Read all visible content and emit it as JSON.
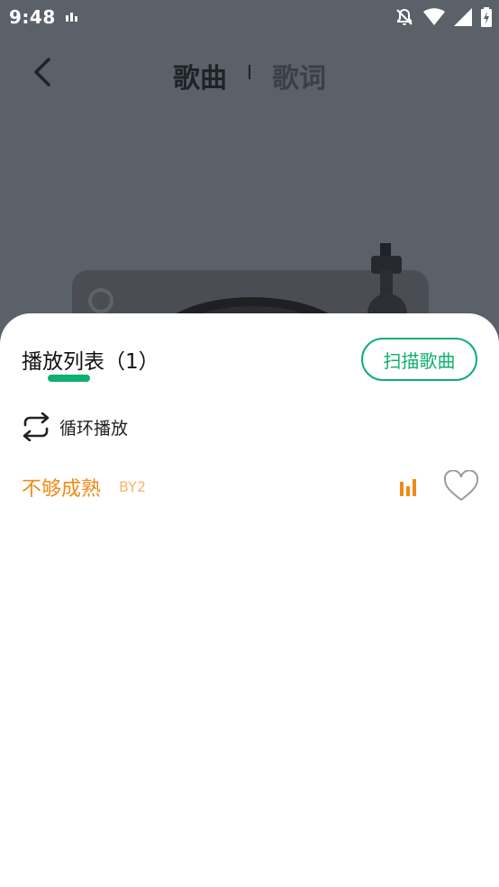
{
  "status_bar": {
    "time": "9:48",
    "icons": [
      "activity-bars-icon",
      "bell-off-icon",
      "wifi-icon",
      "signal-icon",
      "battery-icon"
    ]
  },
  "player": {
    "tabs": [
      {
        "label": "歌曲",
        "active": true
      },
      {
        "label": "歌词",
        "active": false
      }
    ],
    "back_icon": "chevron-left-icon"
  },
  "playlist_sheet": {
    "title": "播放列表（1）",
    "scan_button_label": "扫描歌曲",
    "mode_label": "循环播放",
    "mode_icon": "repeat-icon",
    "songs": [
      {
        "title": "不够成熟",
        "artist": "BY2",
        "playing": true,
        "favorite": false
      }
    ]
  },
  "colors": {
    "accent": "#0eb06f",
    "playing_title": "#f08a18",
    "playing_artist": "#f5b76d",
    "overlay_bg": "#5b6169"
  }
}
